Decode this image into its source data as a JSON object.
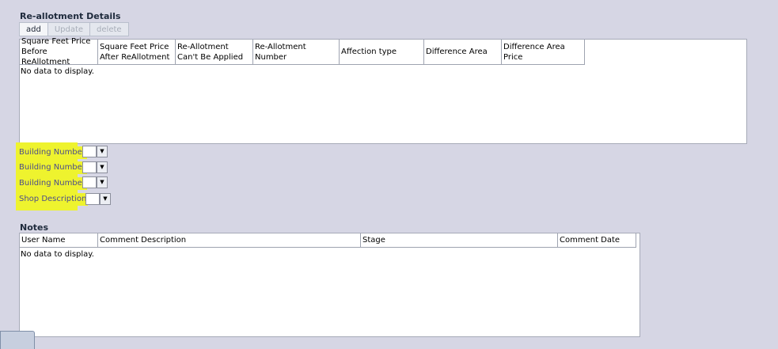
{
  "reallotment": {
    "title": "Re-allotment Details",
    "toolbar": {
      "add": "add",
      "update": "Update",
      "delete": "delete"
    },
    "columns": [
      "Square Feet Price Before ReAllotment",
      "Square Feet Price After ReAllotment",
      "Re-Allotment Can't Be Applied",
      "Re-Allotment Number",
      "Affection type",
      "Difference Area",
      "Difference Area Price"
    ],
    "empty_text": "No data to display."
  },
  "fields": [
    {
      "label": "Building Number",
      "value": ""
    },
    {
      "label": "Building Number",
      "value": ""
    },
    {
      "label": "Building Number",
      "value": ""
    },
    {
      "label": "Shop Description",
      "value": ""
    }
  ],
  "notes": {
    "title": "Notes",
    "columns": [
      "User Name",
      "Comment Description",
      "Stage",
      "Comment Date"
    ],
    "empty_text": "No data to display."
  },
  "colors": {
    "background": "#d6d6e4",
    "highlight": "#eef32e",
    "label_text": "#4d4d8a"
  },
  "icons": {
    "dropdown": "chevron-down-icon"
  }
}
